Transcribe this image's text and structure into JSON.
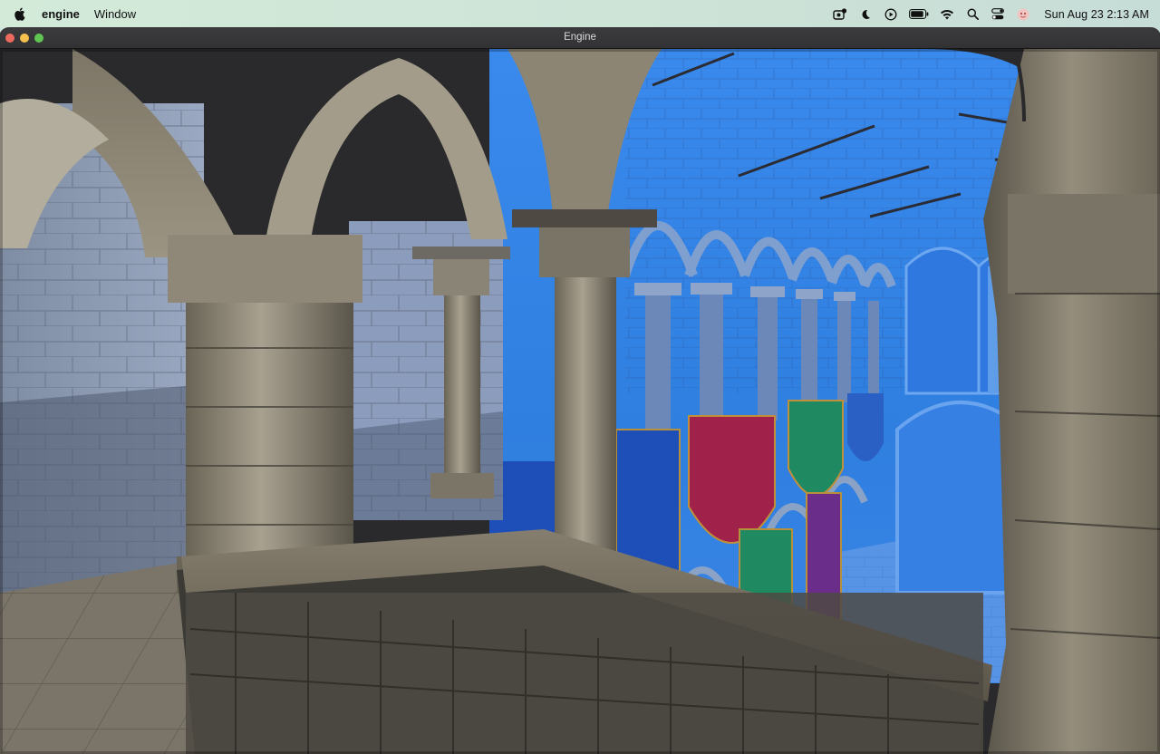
{
  "menubar": {
    "apple_icon": "apple-logo-icon",
    "app_name": "engine",
    "menus": [
      "Window"
    ],
    "status_icons": [
      "screen-record-icon",
      "do-not-disturb-moon-icon",
      "play-circle-icon",
      "battery-icon",
      "wifi-icon",
      "search-icon",
      "control-center-icon",
      "user-avatar-icon"
    ],
    "clock": "Sun Aug 23  2:13 AM"
  },
  "window": {
    "title": "Engine",
    "traffic_lights": {
      "close": "#ed6a5e",
      "minimize": "#f5bf4f",
      "maximize": "#61c554"
    }
  },
  "viewport": {
    "content": "3d-render-sponza-atrium",
    "colors": {
      "stone_light": "#b9b2a3",
      "stone_dark": "#5f5a50",
      "sky_blue": "#2f7fe0",
      "banner_red": "#a0224a",
      "banner_green": "#1f8a62",
      "banner_blue": "#1e4fb8",
      "banner_purple": "#6a2d8a"
    }
  }
}
